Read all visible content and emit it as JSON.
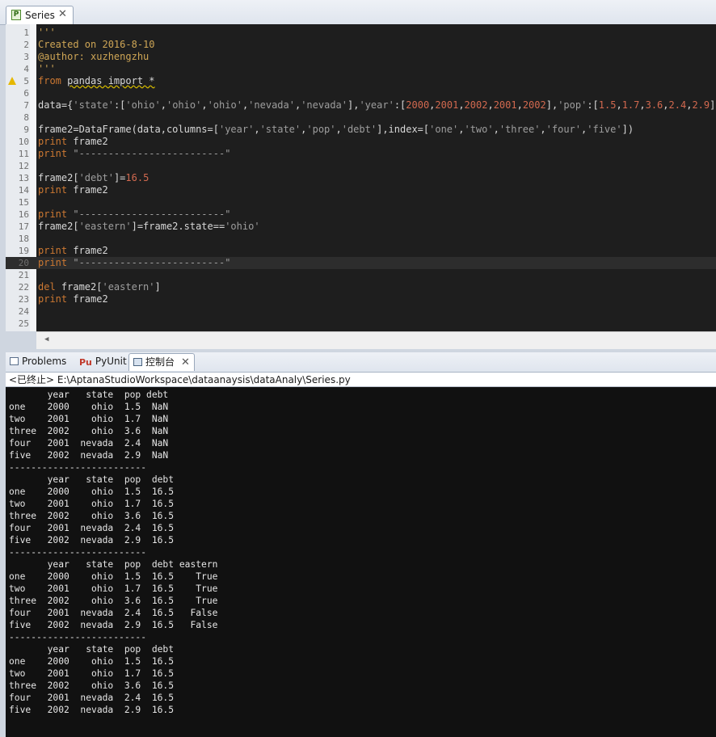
{
  "editor_tab": {
    "title": "Series",
    "icon": "python-file-icon",
    "close_symbol": "✕"
  },
  "code_lines": [
    {
      "num": "1",
      "parts": [
        {
          "t": "'''",
          "c": "c-com"
        }
      ]
    },
    {
      "num": "2",
      "parts": [
        {
          "t": "Created on 2016-8-10",
          "c": "c-com"
        }
      ]
    },
    {
      "num": "3",
      "parts": [
        {
          "t": "@author: xuzhengzhu",
          "c": "c-com"
        }
      ]
    },
    {
      "num": "4",
      "parts": [
        {
          "t": "'''",
          "c": "c-com"
        }
      ]
    },
    {
      "num": "5",
      "warning": true,
      "parts": [
        {
          "t": "from ",
          "c": "c-kw"
        },
        {
          "t": "pandas import *",
          "c": "c-sq"
        }
      ]
    },
    {
      "num": "6",
      "parts": []
    },
    {
      "num": "7",
      "parts": [
        {
          "t": "data={"
        },
        {
          "t": "'state'",
          "c": "c-str"
        },
        {
          "t": ":["
        },
        {
          "t": "'ohio'",
          "c": "c-str"
        },
        {
          "t": ","
        },
        {
          "t": "'ohio'",
          "c": "c-str"
        },
        {
          "t": ","
        },
        {
          "t": "'ohio'",
          "c": "c-str"
        },
        {
          "t": ","
        },
        {
          "t": "'nevada'",
          "c": "c-str"
        },
        {
          "t": ","
        },
        {
          "t": "'nevada'",
          "c": "c-str"
        },
        {
          "t": "],"
        },
        {
          "t": "'year'",
          "c": "c-str"
        },
        {
          "t": ":["
        },
        {
          "t": "2000",
          "c": "c-num"
        },
        {
          "t": ","
        },
        {
          "t": "2001",
          "c": "c-num"
        },
        {
          "t": ","
        },
        {
          "t": "2002",
          "c": "c-num"
        },
        {
          "t": ","
        },
        {
          "t": "2001",
          "c": "c-num"
        },
        {
          "t": ","
        },
        {
          "t": "2002",
          "c": "c-num"
        },
        {
          "t": "],"
        },
        {
          "t": "'pop'",
          "c": "c-str"
        },
        {
          "t": ":["
        },
        {
          "t": "1.5",
          "c": "c-num"
        },
        {
          "t": ","
        },
        {
          "t": "1.7",
          "c": "c-num"
        },
        {
          "t": ","
        },
        {
          "t": "3.6",
          "c": "c-num"
        },
        {
          "t": ","
        },
        {
          "t": "2.4",
          "c": "c-num"
        },
        {
          "t": ","
        },
        {
          "t": "2.9",
          "c": "c-num"
        },
        {
          "t": "]}"
        }
      ]
    },
    {
      "num": "8",
      "parts": []
    },
    {
      "num": "9",
      "parts": [
        {
          "t": "frame2=DataFrame(data,columns=["
        },
        {
          "t": "'year'",
          "c": "c-str"
        },
        {
          "t": ","
        },
        {
          "t": "'state'",
          "c": "c-str"
        },
        {
          "t": ","
        },
        {
          "t": "'pop'",
          "c": "c-str"
        },
        {
          "t": ","
        },
        {
          "t": "'debt'",
          "c": "c-str"
        },
        {
          "t": "],index=["
        },
        {
          "t": "'one'",
          "c": "c-str"
        },
        {
          "t": ","
        },
        {
          "t": "'two'",
          "c": "c-str"
        },
        {
          "t": ","
        },
        {
          "t": "'three'",
          "c": "c-str"
        },
        {
          "t": ","
        },
        {
          "t": "'four'",
          "c": "c-str"
        },
        {
          "t": ","
        },
        {
          "t": "'five'",
          "c": "c-str"
        },
        {
          "t": "])"
        }
      ]
    },
    {
      "num": "10",
      "parts": [
        {
          "t": "print",
          "c": "c-kw"
        },
        {
          "t": " frame2"
        }
      ]
    },
    {
      "num": "11",
      "parts": [
        {
          "t": "print",
          "c": "c-kw"
        },
        {
          "t": " "
        },
        {
          "t": "\"-------------------------\"",
          "c": "c-str"
        }
      ]
    },
    {
      "num": "12",
      "parts": []
    },
    {
      "num": "13",
      "parts": [
        {
          "t": "frame2["
        },
        {
          "t": "'debt'",
          "c": "c-str"
        },
        {
          "t": "]="
        },
        {
          "t": "16.5",
          "c": "c-num"
        }
      ]
    },
    {
      "num": "14",
      "parts": [
        {
          "t": "print",
          "c": "c-kw"
        },
        {
          "t": " frame2"
        }
      ]
    },
    {
      "num": "15",
      "parts": []
    },
    {
      "num": "16",
      "parts": [
        {
          "t": "print",
          "c": "c-kw"
        },
        {
          "t": " "
        },
        {
          "t": "\"-------------------------\"",
          "c": "c-str"
        }
      ]
    },
    {
      "num": "17",
      "parts": [
        {
          "t": "frame2["
        },
        {
          "t": "'eastern'",
          "c": "c-str"
        },
        {
          "t": "]=frame2.state=="
        },
        {
          "t": "'ohio'",
          "c": "c-str"
        }
      ]
    },
    {
      "num": "18",
      "parts": []
    },
    {
      "num": "19",
      "parts": [
        {
          "t": "print",
          "c": "c-kw"
        },
        {
          "t": " frame2"
        }
      ]
    },
    {
      "num": "20",
      "current": true,
      "parts": [
        {
          "t": "print",
          "c": "c-kw"
        },
        {
          "t": " "
        },
        {
          "t": "\"-------------------------\"",
          "c": "c-str"
        }
      ]
    },
    {
      "num": "21",
      "parts": []
    },
    {
      "num": "22",
      "parts": [
        {
          "t": "del",
          "c": "c-kw"
        },
        {
          "t": " frame2["
        },
        {
          "t": "'eastern'",
          "c": "c-str"
        },
        {
          "t": "]"
        }
      ]
    },
    {
      "num": "23",
      "parts": [
        {
          "t": "print",
          "c": "c-kw"
        },
        {
          "t": " frame2"
        }
      ]
    },
    {
      "num": "24",
      "parts": []
    },
    {
      "num": "25",
      "parts": []
    }
  ],
  "console_tabs": [
    {
      "label": "Problems",
      "icon": "problems-icon",
      "active": false
    },
    {
      "label": "PyUnit",
      "icon": "pyunit-icon",
      "active": false
    },
    {
      "label": "控制台",
      "icon": "console-icon",
      "active": true,
      "close": "✕"
    }
  ],
  "console_path": "<已终止> E:\\AptanaStudioWorkspace\\dataanaysis\\dataAnaly\\Series.py",
  "console_output": [
    "       year   state  pop debt",
    "one    2000    ohio  1.5  NaN",
    "two    2001    ohio  1.7  NaN",
    "three  2002    ohio  3.6  NaN",
    "four   2001  nevada  2.4  NaN",
    "five   2002  nevada  2.9  NaN",
    "-------------------------",
    "       year   state  pop  debt",
    "one    2000    ohio  1.5  16.5",
    "two    2001    ohio  1.7  16.5",
    "three  2002    ohio  3.6  16.5",
    "four   2001  nevada  2.4  16.5",
    "five   2002  nevada  2.9  16.5",
    "-------------------------",
    "       year   state  pop  debt eastern",
    "one    2000    ohio  1.5  16.5    True",
    "two    2001    ohio  1.7  16.5    True",
    "three  2002    ohio  3.6  16.5    True",
    "four   2001  nevada  2.4  16.5   False",
    "five   2002  nevada  2.9  16.5   False",
    "-------------------------",
    "       year   state  pop  debt",
    "one    2000    ohio  1.5  16.5",
    "two    2001    ohio  1.7  16.5",
    "three  2002    ohio  3.6  16.5",
    "four   2001  nevada  2.4  16.5",
    "five   2002  nevada  2.9  16.5"
  ]
}
